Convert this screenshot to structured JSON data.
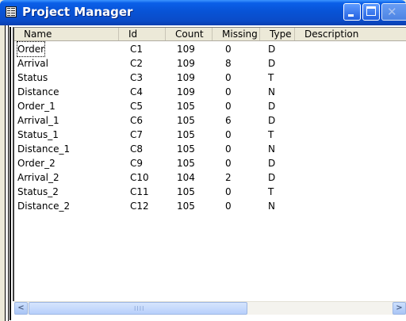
{
  "window": {
    "title": "Project Manager",
    "icon": "project-manager-icon"
  },
  "titlebar_buttons": [
    {
      "name": "minimize-button",
      "icon": "minimize-icon"
    },
    {
      "name": "maximize-button",
      "icon": "maximize-icon"
    },
    {
      "name": "close-button",
      "icon": "close-icon"
    }
  ],
  "table": {
    "headers": [
      "Name",
      "Id",
      "Count",
      "Missing",
      "Type",
      "Description"
    ],
    "rows": [
      {
        "name": "Order",
        "id": "C1",
        "count": "109",
        "missing": "0",
        "type": "D",
        "description": ""
      },
      {
        "name": "Arrival",
        "id": "C2",
        "count": "109",
        "missing": "8",
        "type": "D",
        "description": ""
      },
      {
        "name": "Status",
        "id": "C3",
        "count": "109",
        "missing": "0",
        "type": "T",
        "description": ""
      },
      {
        "name": "Distance",
        "id": "C4",
        "count": "109",
        "missing": "0",
        "type": "N",
        "description": ""
      },
      {
        "name": "Order_1",
        "id": "C5",
        "count": "105",
        "missing": "0",
        "type": "D",
        "description": ""
      },
      {
        "name": "Arrival_1",
        "id": "C6",
        "count": "105",
        "missing": "6",
        "type": "D",
        "description": ""
      },
      {
        "name": "Status_1",
        "id": "C7",
        "count": "105",
        "missing": "0",
        "type": "T",
        "description": ""
      },
      {
        "name": "Distance_1",
        "id": "C8",
        "count": "105",
        "missing": "0",
        "type": "N",
        "description": ""
      },
      {
        "name": "Order_2",
        "id": "C9",
        "count": "105",
        "missing": "0",
        "type": "D",
        "description": ""
      },
      {
        "name": "Arrival_2",
        "id": "C10",
        "count": "104",
        "missing": "2",
        "type": "D",
        "description": ""
      },
      {
        "name": "Status_2",
        "id": "C11",
        "count": "105",
        "missing": "0",
        "type": "T",
        "description": ""
      },
      {
        "name": "Distance_2",
        "id": "C12",
        "count": "105",
        "missing": "0",
        "type": "N",
        "description": ""
      }
    ],
    "focused_row": 0
  },
  "scrollbar": {
    "left_arrow": "<",
    "right_arrow": ">",
    "grip": "IIII"
  },
  "colors": {
    "titlebar": "#0853d6",
    "title_text": "#ffffff",
    "header_background": "#ece9d8",
    "list_background": "#ffffff"
  }
}
